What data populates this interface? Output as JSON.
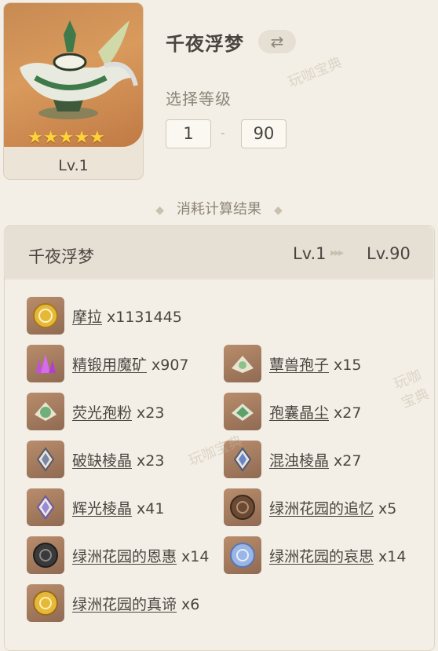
{
  "header": {
    "title": "千夜浮梦",
    "select_level_label": "选择等级",
    "level_from": "1",
    "level_to": "90",
    "dash": "-",
    "card_level": "Lv.1",
    "stars": "★★★★★"
  },
  "section_title": "消耗计算结果",
  "panel": {
    "name": "千夜浮梦",
    "lv_from": "Lv.1",
    "arrows": "▸▸▸",
    "lv_to": "Lv.90"
  },
  "materials": [
    {
      "name": "摩拉",
      "count": "x1131445",
      "icon": "mora-coin-icon"
    },
    {
      "name": "精锻用魔矿",
      "count": "x907",
      "icon": "purple-crystal-icon"
    },
    {
      "name": "蕈兽孢子",
      "count": "x15",
      "icon": "spore-icon"
    },
    {
      "name": "荧光孢粉",
      "count": "x23",
      "icon": "spore-powder-icon"
    },
    {
      "name": "孢囊晶尘",
      "count": "x27",
      "icon": "spore-crystal-icon"
    },
    {
      "name": "破缺棱晶",
      "count": "x23",
      "icon": "prism-icon"
    },
    {
      "name": "混浊棱晶",
      "count": "x27",
      "icon": "prism-icon"
    },
    {
      "name": "辉光棱晶",
      "count": "x41",
      "icon": "prism-icon"
    },
    {
      "name": "绿洲花园的追忆",
      "count": "x5",
      "icon": "bronze-medallion-icon"
    },
    {
      "name": "绿洲花园的恩惠",
      "count": "x14",
      "icon": "dark-medallion-icon"
    },
    {
      "name": "绿洲花园的哀思",
      "count": "x14",
      "icon": "blue-medallion-icon"
    },
    {
      "name": "绿洲花园的真谛",
      "count": "x6",
      "icon": "gold-medallion-icon"
    }
  ],
  "watermark": "玩咖宝典"
}
